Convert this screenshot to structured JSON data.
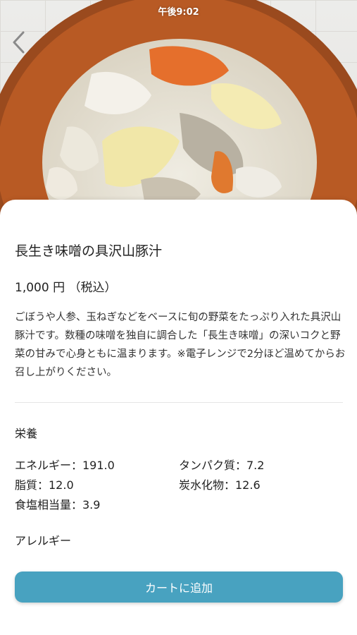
{
  "status_bar": {
    "time": "午後9:02"
  },
  "nav": {
    "back_icon": "chevron-left-icon"
  },
  "product": {
    "name": "長生き味噌の具沢山豚汁",
    "price": "1,000 円 （税込）",
    "description": "ごぼうや人参、玉ねぎなどをベースに旬の野菜をたっぷり入れた具沢山豚汁です。数種の味噌を独自に調合した「長生き味噌」の深いコクと野菜の甘みで心身ともに温まります。※電子レンジで2分ほど温めてからお召し上がりください。"
  },
  "nutrition": {
    "label": "栄養",
    "items": [
      "エネルギー：191.0",
      "タンパク質：7.2",
      "脂質：12.0",
      "炭水化物：12.6",
      "食塩相当量：3.9"
    ]
  },
  "allergy": {
    "label": "アレルギー"
  },
  "cart": {
    "add_label": "カートに追加"
  },
  "colors": {
    "accent": "#48a2c0",
    "text": "#222222"
  }
}
